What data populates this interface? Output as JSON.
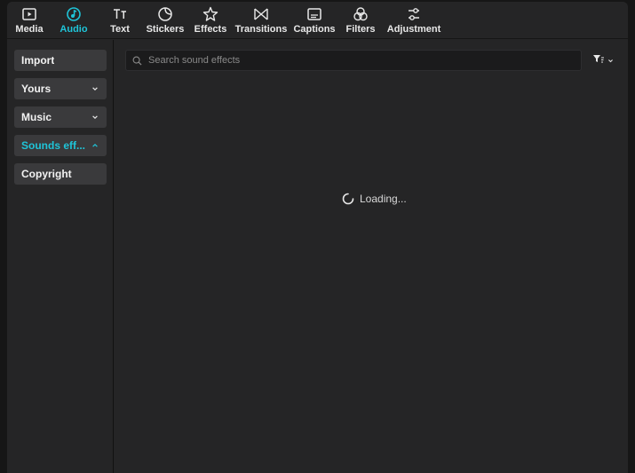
{
  "toolbar": {
    "tabs": [
      {
        "label": "Media",
        "icon": "media-icon"
      },
      {
        "label": "Audio",
        "icon": "audio-icon",
        "active": true
      },
      {
        "label": "Text",
        "icon": "text-icon"
      },
      {
        "label": "Stickers",
        "icon": "stickers-icon"
      },
      {
        "label": "Effects",
        "icon": "effects-icon"
      },
      {
        "label": "Transitions",
        "icon": "transitions-icon"
      },
      {
        "label": "Captions",
        "icon": "captions-icon"
      },
      {
        "label": "Filters",
        "icon": "filters-icon"
      },
      {
        "label": "Adjustment",
        "icon": "adjustment-icon"
      }
    ]
  },
  "sidebar": {
    "items": [
      {
        "label": "Import"
      },
      {
        "label": "Yours",
        "chevron": "down"
      },
      {
        "label": "Music",
        "chevron": "down"
      },
      {
        "label": "Sounds eff...",
        "chevron": "up",
        "active": true
      },
      {
        "label": "Copyright"
      }
    ]
  },
  "search": {
    "placeholder": "Search sound effects",
    "value": ""
  },
  "status": {
    "loading_text": "Loading..."
  },
  "colors": {
    "accent": "#1fc4d8",
    "panel": "#252526",
    "button": "#3a3a3c"
  }
}
